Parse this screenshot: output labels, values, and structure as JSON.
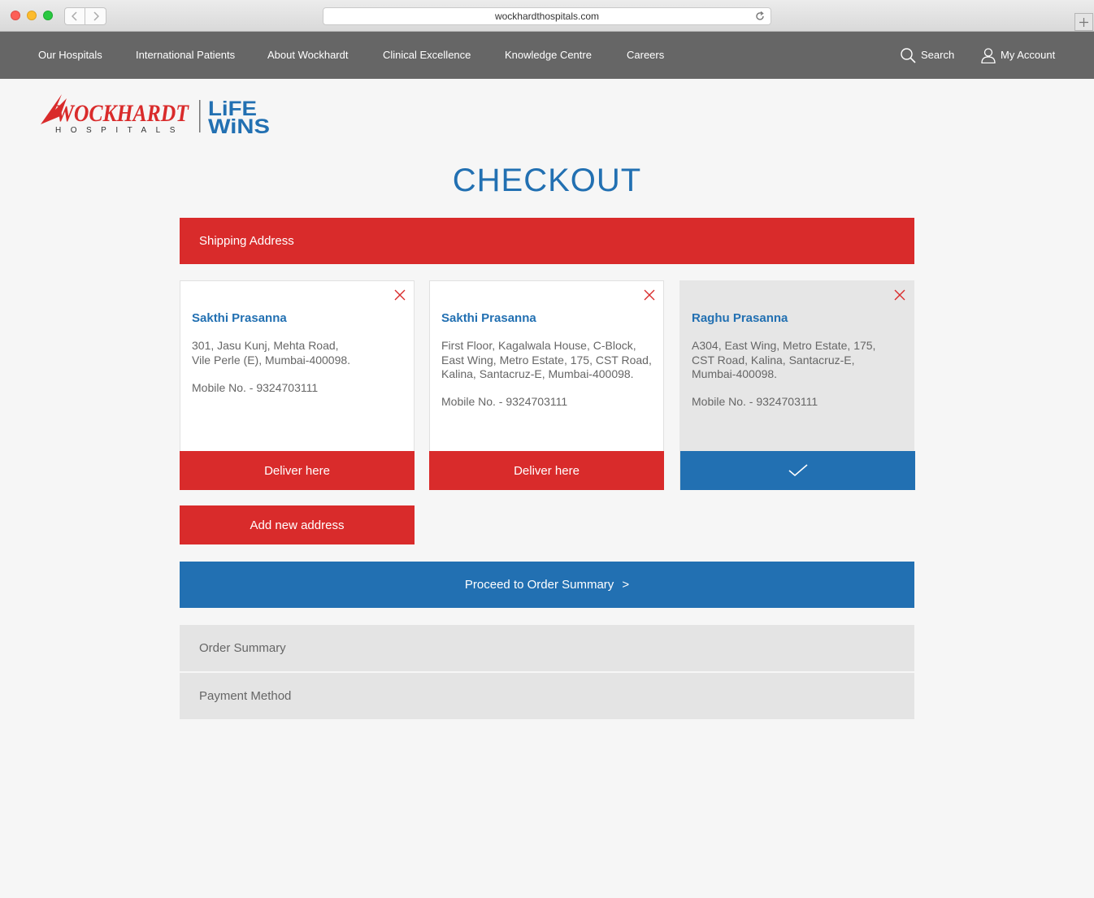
{
  "browser": {
    "url": "wockhardthospitals.com"
  },
  "nav": {
    "items": [
      {
        "label": "Our Hospitals"
      },
      {
        "label": "International Patients"
      },
      {
        "label": "About Wockhardt"
      },
      {
        "label": "Clinical Excellence"
      },
      {
        "label": "Knowledge Centre"
      },
      {
        "label": "Careers"
      }
    ],
    "search_label": "Search",
    "account_label": "My Account"
  },
  "logo": {
    "brand": "WOCKHARDT",
    "sub": "HOSPITALS",
    "tagline_top": "LiFE",
    "tagline_bottom": "WiNS"
  },
  "page": {
    "title": "CHECKOUT",
    "shipping_header": "Shipping Address",
    "addresses": [
      {
        "name": "Sakthi Prasanna",
        "lines": [
          "301, Jasu Kunj, Mehta Road,",
          "Vile Perle (E), Mumbai-400098."
        ],
        "mobile": "Mobile No. - 9324703111",
        "action": "Deliver here",
        "selected": false
      },
      {
        "name": "Sakthi Prasanna",
        "lines": [
          "First Floor, Kagalwala House, C-Block,",
          "East Wing, Metro Estate, 175, CST Road,",
          "Kalina, Santacruz-E, Mumbai-400098."
        ],
        "mobile": "Mobile No. - 9324703111",
        "action": "Deliver here",
        "selected": false
      },
      {
        "name": "Raghu Prasanna",
        "lines": [
          "A304, East Wing, Metro Estate, 175,",
          "CST Road, Kalina, Santacruz-E,",
          "Mumbai-400098."
        ],
        "mobile": "Mobile No. - 9324703111",
        "action": "",
        "selected": true
      }
    ],
    "add_address": "Add new address",
    "proceed": "Proceed to Order Summary",
    "proceed_arrow": ">",
    "order_summary": "Order Summary",
    "payment_method": "Payment Method"
  },
  "colors": {
    "red": "#d92b2b",
    "blue": "#2270b2",
    "nav_gray": "#666666"
  }
}
